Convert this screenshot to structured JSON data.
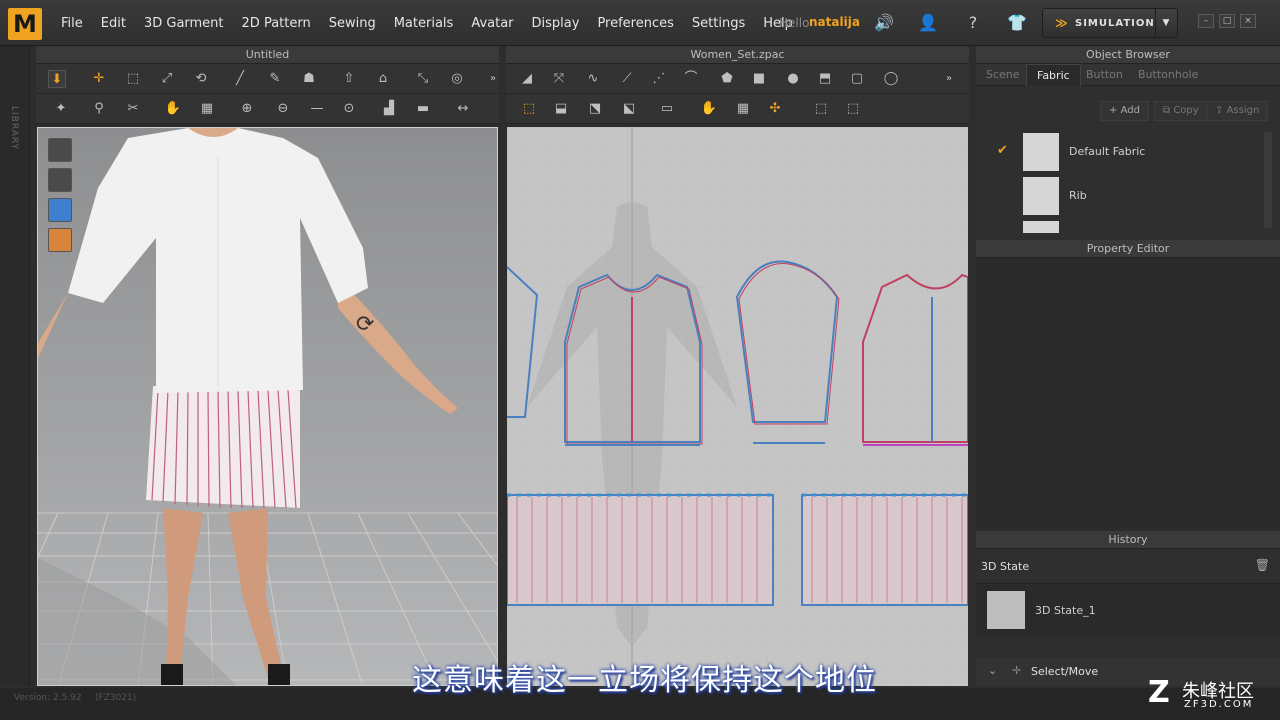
{
  "app": {
    "logo": "M"
  },
  "menu": [
    "File",
    "Edit",
    "3D Garment",
    "2D Pattern",
    "Sewing",
    "Materials",
    "Avatar",
    "Display",
    "Preferences",
    "Settings",
    "Help"
  ],
  "user": {
    "hello": "Hello",
    "name": "natalija"
  },
  "simulation": {
    "label": "SIMULATION"
  },
  "library": {
    "label": "LIBRARY"
  },
  "panels": {
    "viewport3d": {
      "title": "Untitled"
    },
    "viewport2d": {
      "title": "Women_Set.zpac"
    },
    "object_browser": {
      "title": "Object Browser",
      "tabs": [
        "Scene",
        "Fabric",
        "Button",
        "Buttonhole"
      ],
      "active_tab": "Fabric",
      "buttons": {
        "add": "Add",
        "copy": "Copy",
        "assign": "Assign"
      },
      "fabrics": [
        {
          "name": "Default Fabric",
          "checked": true
        },
        {
          "name": "Rib",
          "checked": false
        }
      ]
    },
    "property_editor": {
      "title": "Property Editor"
    },
    "history": {
      "title": "History",
      "section": "3D State",
      "items": [
        "3D State_1"
      ]
    },
    "tool_hint": "Select/Move"
  },
  "status": {
    "version": "Version: 2.5.92",
    "code": "(FZ3021)"
  },
  "subtitle": "这意味着这一立场将保持这个地位",
  "watermark": {
    "brand": "朱峰社区",
    "url": "ZF3D.COM"
  },
  "colors": {
    "accent": "#f0a320",
    "pattern_blue": "#4a7fc0",
    "pattern_red": "#c04060"
  }
}
